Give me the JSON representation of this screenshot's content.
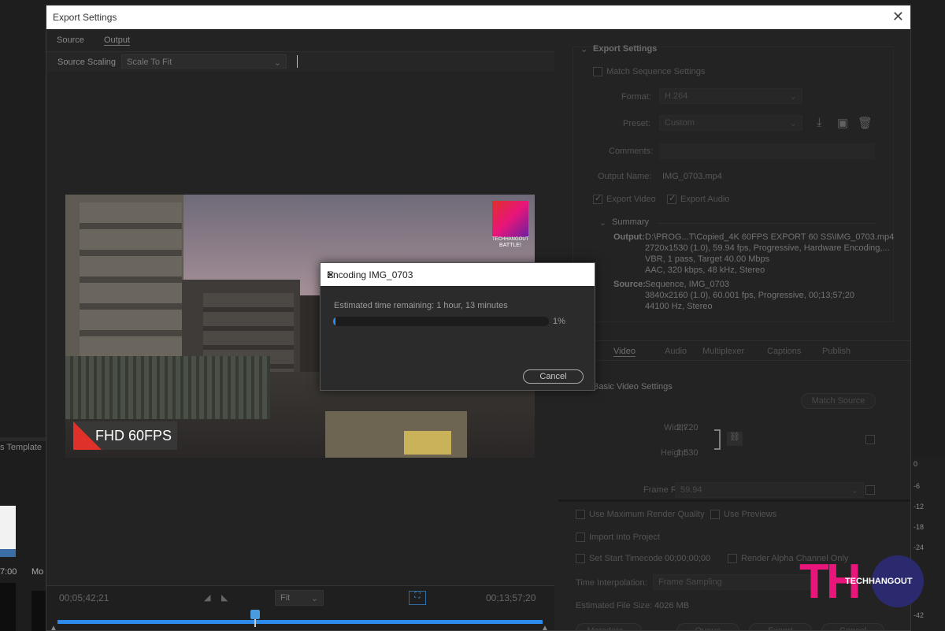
{
  "window": {
    "title": "Export Settings",
    "close_glyph": "✕"
  },
  "left_tabs": [
    "Source",
    "Output"
  ],
  "source_scaling": {
    "label": "Source Scaling",
    "value": "Scale To Fit"
  },
  "preview": {
    "badge": "FHD 60FPS",
    "logo_line1": "TECHHANGOUT",
    "logo_line2": "BATTLE!"
  },
  "timeline": {
    "current": "00;05;42;21",
    "fit": "Fit",
    "end": "00;13;57;20"
  },
  "export": {
    "section": "Export Settings",
    "match_sequence": "Match Sequence Settings",
    "format_label": "Format:",
    "format_value": "H.264",
    "preset_label": "Preset:",
    "preset_value": "Custom",
    "comments_label": "Comments:",
    "output_name_label": "Output Name:",
    "output_name_value": "IMG_0703.mp4",
    "export_video": "Export Video",
    "export_audio": "Export Audio",
    "summary": "Summary",
    "output_label": "Output:",
    "output_lines": [
      "D:\\PROG...T\\Copied_4K 60FPS EXPORT 60 SS\\IMG_0703.mp4",
      "2720x1530 (1.0), 59.94 fps, Progressive, Hardware Encoding,...",
      "VBR, 1 pass, Target 40.00 Mbps",
      "AAC, 320 kbps, 48 kHz, Stereo"
    ],
    "source_label": "Source:",
    "source_lines": [
      "Sequence, IMG_0703",
      "3840x2160 (1.0), 60.001 fps, Progressive, 00;13;57;20",
      "44100 Hz, Stereo"
    ]
  },
  "right_tabs": [
    "Video",
    "Audio",
    "Multiplexer",
    "Captions",
    "Publish"
  ],
  "video": {
    "section": "Basic Video Settings",
    "match_source": "Match Source",
    "width_label": "Width:",
    "width_value": "2,720",
    "height_label": "Height:",
    "height_value": "1,530",
    "frame_rate_label": "Frame Rate:",
    "frame_rate_value": "59.94"
  },
  "bottom": {
    "max_render": "Use Maximum Render Quality",
    "use_previews": "Use Previews",
    "import_project": "Import Into Project",
    "set_start_tc": "Set Start Timecode",
    "start_tc_value": "00;00;00;00",
    "render_alpha": "Render Alpha Channel Only",
    "interp_label": "Time Interpolation:",
    "interp_value": "Frame Sampling",
    "file_size_label": "Estimated File Size:",
    "file_size_value": "4026 MB",
    "buttons": [
      "Metadata...",
      "Queue",
      "Export",
      "Cancel"
    ]
  },
  "background": {
    "template_text": "s Template",
    "time_700": "7:00",
    "mo": "Mo",
    "db_ticks": [
      "0",
      "-6",
      "-12",
      "-18",
      "-24",
      "-42"
    ]
  },
  "modal": {
    "title": "Encoding IMG_0703",
    "close_glyph": "✕",
    "estimate": "Estimated time remaining: 1 hour, 13 minutes",
    "percent": "1%",
    "progress": 0.01,
    "cancel": "Cancel"
  },
  "watermark": {
    "letters": "TH",
    "text": "TECHHANGOUT"
  },
  "colors": {
    "accent": "#2d8ceb",
    "watermark_pink": "#e8157a",
    "watermark_navy": "#2c2a6e"
  }
}
